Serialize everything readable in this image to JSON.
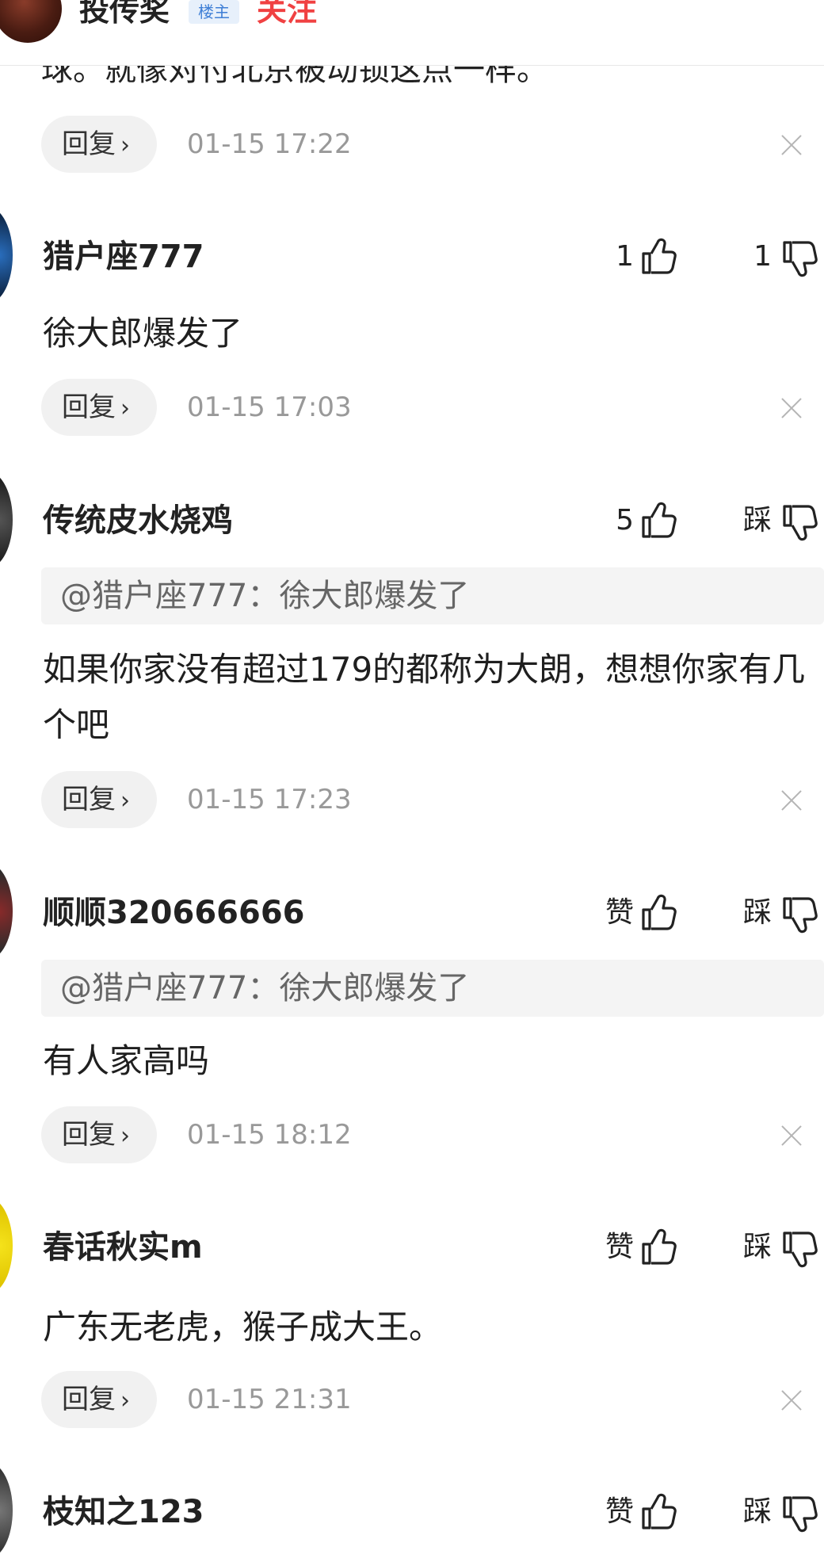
{
  "header": {
    "username": "投传奖",
    "badge": "楼主",
    "follow_label": "关注",
    "partial_text": "球。就像对付北京被动锁这点一样。"
  },
  "top_reply": {
    "reply_label": "回复",
    "time": "01-15 17:22"
  },
  "comments": [
    {
      "username": "猎户座777",
      "like": "1",
      "dislike": "1",
      "content": "徐大郎爆发了",
      "reply_label": "回复",
      "time": "01-15 17:03"
    },
    {
      "username": "传统皮水烧鸡",
      "like": "5",
      "dislike": "踩",
      "quote": "@猎户座777：徐大郎爆发了",
      "content": "如果你家没有超过179的都称为大朗，想想你家有几个吧",
      "reply_label": "回复",
      "time": "01-15 17:23"
    },
    {
      "username": "顺顺320666666",
      "like": "赞",
      "dislike": "踩",
      "quote": "@猎户座777：徐大郎爆发了",
      "content": "有人家高吗",
      "reply_label": "回复",
      "time": "01-15 18:12"
    },
    {
      "username": "春话秋实m",
      "like": "赞",
      "dislike": "踩",
      "content": "广东无老虎，猴子成大王。",
      "reply_label": "回复",
      "time": "01-15 21:31"
    },
    {
      "username": "枝知之123",
      "like": "赞",
      "dislike": "踩"
    }
  ],
  "icons": {
    "like": "thumbs-up-icon",
    "dislike": "thumbs-down-icon",
    "close": "close-icon",
    "reply_arrow": "chevron-right-icon"
  },
  "colors": {
    "follow": "#f04142",
    "badge_text": "#3f7fd6",
    "time": "#999999"
  }
}
